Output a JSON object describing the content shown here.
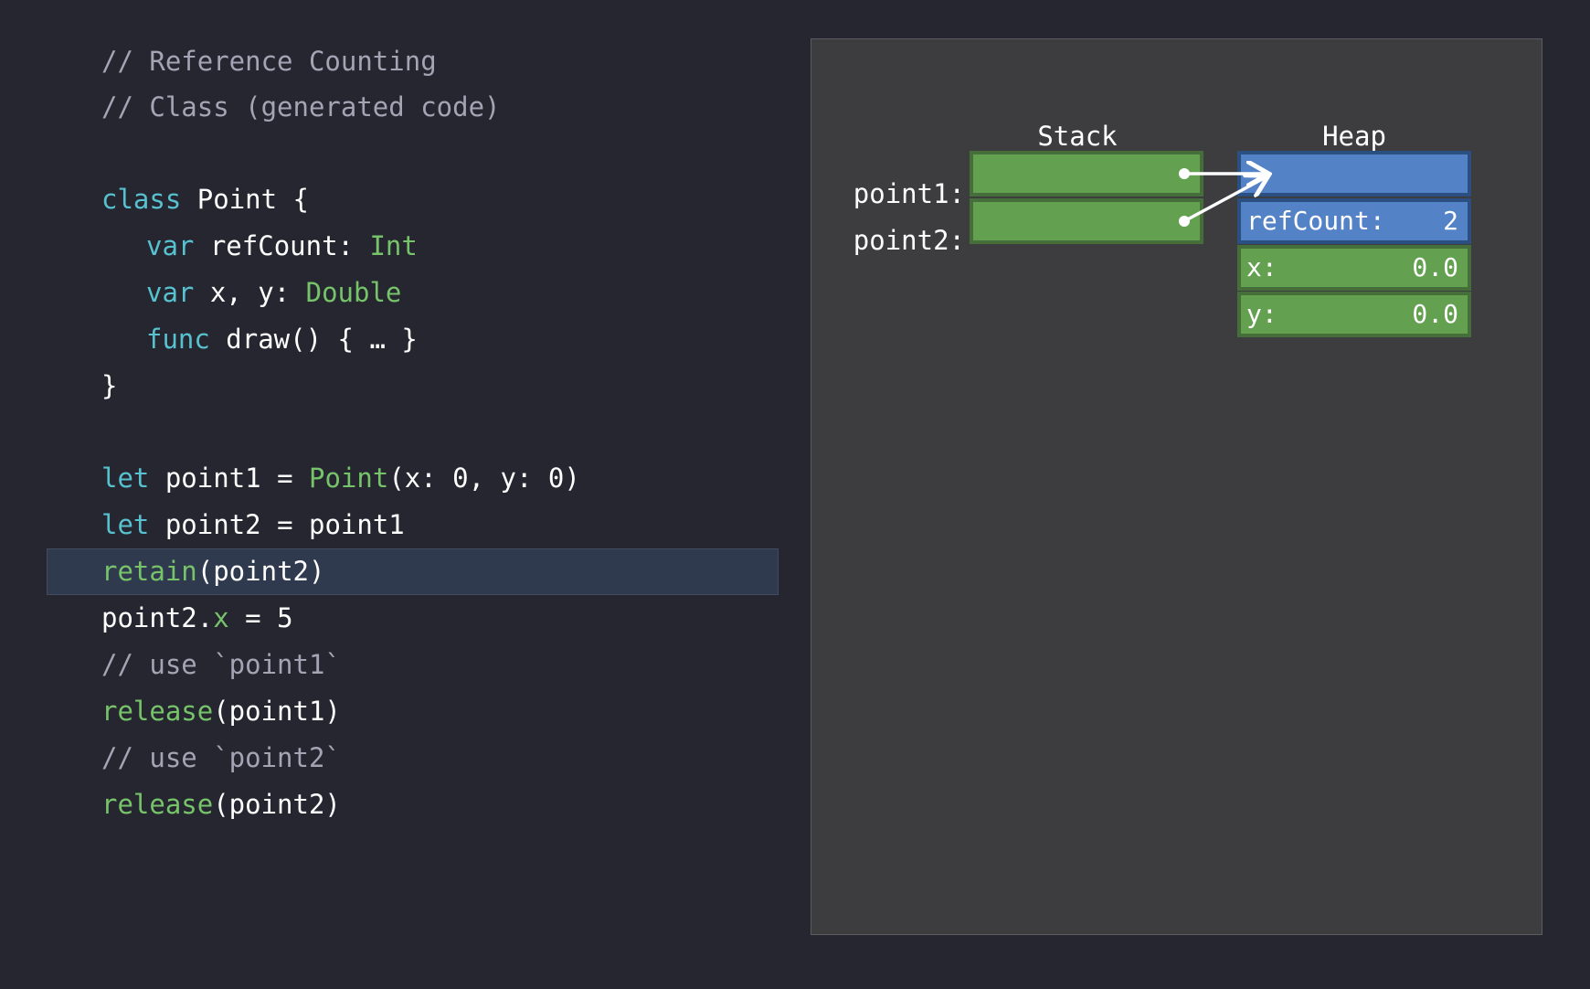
{
  "code": {
    "lines": [
      [
        {
          "t": "// Reference Counting",
          "c": "comment"
        }
      ],
      [
        {
          "t": "// Class (generated code)",
          "c": "comment"
        }
      ],
      [
        {
          "t": "class",
          "c": "kw"
        },
        {
          "t": " Point {",
          "c": "plain"
        }
      ],
      [
        {
          "t": "var",
          "c": "kw"
        },
        {
          "t": " refCount: ",
          "c": "plain"
        },
        {
          "t": "Int",
          "c": "type"
        }
      ],
      [
        {
          "t": "var",
          "c": "kw"
        },
        {
          "t": " x, y: ",
          "c": "plain"
        },
        {
          "t": "Double",
          "c": "type"
        }
      ],
      [
        {
          "t": "func",
          "c": "kw"
        },
        {
          "t": " draw() { … }",
          "c": "plain"
        }
      ],
      [
        {
          "t": "}",
          "c": "plain"
        }
      ],
      [
        {
          "t": "let",
          "c": "kw"
        },
        {
          "t": " point1 = ",
          "c": "plain"
        },
        {
          "t": "Point",
          "c": "type"
        },
        {
          "t": "(x: 0, y: 0)",
          "c": "plain"
        }
      ],
      [
        {
          "t": "let",
          "c": "kw"
        },
        {
          "t": " point2 = point1",
          "c": "plain"
        }
      ],
      [
        {
          "t": "retain",
          "c": "type"
        },
        {
          "t": "(point2)",
          "c": "plain"
        }
      ],
      [
        {
          "t": "point2.",
          "c": "plain"
        },
        {
          "t": "x",
          "c": "type"
        },
        {
          "t": " = 5",
          "c": "plain"
        }
      ],
      [
        {
          "t": "// use `point1`",
          "c": "comment"
        }
      ],
      [
        {
          "t": "release",
          "c": "type"
        },
        {
          "t": "(point1)",
          "c": "plain"
        }
      ],
      [
        {
          "t": "// use `point2`",
          "c": "comment"
        }
      ],
      [
        {
          "t": "release",
          "c": "type"
        },
        {
          "t": "(point2)",
          "c": "plain"
        }
      ]
    ],
    "highlighted_line": "retain(point2)"
  },
  "diagram": {
    "stack_header": "Stack",
    "heap_header": "Heap",
    "stack_vars": [
      "point1:",
      "point2:"
    ],
    "heap_fields": [
      {
        "key": "refCount:",
        "value": "2"
      },
      {
        "key": "x:",
        "value": "0.0"
      },
      {
        "key": "y:",
        "value": "0.0"
      }
    ]
  },
  "colors": {
    "background": "#252630",
    "panel": "#3d3d40",
    "stack_cell": "#63a04f",
    "heap_header_cell": "#5382c7",
    "keyword": "#58c1cf",
    "type": "#77c36a",
    "comment": "#a3a4b4",
    "highlight": "#2f3a4e"
  }
}
